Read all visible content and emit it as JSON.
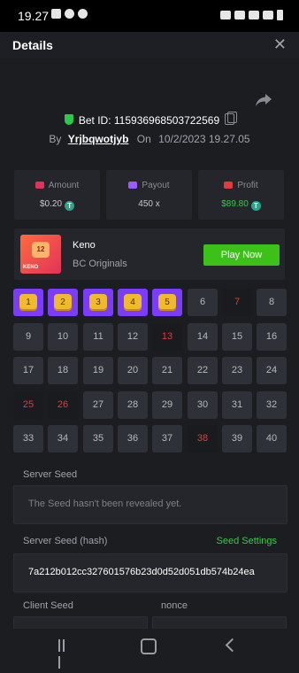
{
  "status": {
    "time": "19.27"
  },
  "header": {
    "title": "Details",
    "close_glyph": "✕"
  },
  "bet": {
    "id_label": "Bet ID:",
    "id_value": "115936968503722569",
    "by_label": "By",
    "user": "Yrjbqwotjyb",
    "on_label": "On",
    "datetime": "10/2/2023 19.27.05"
  },
  "stats": {
    "amount_label": "Amount",
    "amount_value": "$0.20",
    "payout_label": "Payout",
    "payout_value": "450 x",
    "profit_label": "Profit",
    "profit_value": "$89.80"
  },
  "coin_glyph": "T",
  "game": {
    "name": "Keno",
    "provider": "BC Originals",
    "play_label": "Play Now",
    "thumb_ball": "12",
    "thumb_label": "KENO"
  },
  "grid": {
    "cells": [
      {
        "n": "1",
        "state": "hit"
      },
      {
        "n": "2",
        "state": "hit"
      },
      {
        "n": "3",
        "state": "hit"
      },
      {
        "n": "4",
        "state": "hit"
      },
      {
        "n": "5",
        "state": "hit"
      },
      {
        "n": "6",
        "state": "normal"
      },
      {
        "n": "7",
        "state": "pick"
      },
      {
        "n": "8",
        "state": "normal"
      },
      {
        "n": "9",
        "state": "normal"
      },
      {
        "n": "10",
        "state": "normal"
      },
      {
        "n": "11",
        "state": "normal"
      },
      {
        "n": "12",
        "state": "normal"
      },
      {
        "n": "13",
        "state": "pick"
      },
      {
        "n": "14",
        "state": "normal"
      },
      {
        "n": "15",
        "state": "normal"
      },
      {
        "n": "16",
        "state": "normal"
      },
      {
        "n": "17",
        "state": "normal"
      },
      {
        "n": "18",
        "state": "normal"
      },
      {
        "n": "19",
        "state": "normal"
      },
      {
        "n": "20",
        "state": "normal"
      },
      {
        "n": "21",
        "state": "normal"
      },
      {
        "n": "22",
        "state": "normal"
      },
      {
        "n": "23",
        "state": "normal"
      },
      {
        "n": "24",
        "state": "normal"
      },
      {
        "n": "25",
        "state": "pick"
      },
      {
        "n": "26",
        "state": "pick"
      },
      {
        "n": "27",
        "state": "normal"
      },
      {
        "n": "28",
        "state": "normal"
      },
      {
        "n": "29",
        "state": "normal"
      },
      {
        "n": "30",
        "state": "normal"
      },
      {
        "n": "31",
        "state": "normal"
      },
      {
        "n": "32",
        "state": "normal"
      },
      {
        "n": "33",
        "state": "normal"
      },
      {
        "n": "34",
        "state": "normal"
      },
      {
        "n": "35",
        "state": "normal"
      },
      {
        "n": "36",
        "state": "normal"
      },
      {
        "n": "37",
        "state": "normal"
      },
      {
        "n": "38",
        "state": "pick"
      },
      {
        "n": "39",
        "state": "normal"
      },
      {
        "n": "40",
        "state": "normal"
      }
    ]
  },
  "seeds": {
    "server_label": "Server Seed",
    "server_value": "The Seed hasn't been revealed yet.",
    "hash_label": "Server Seed (hash)",
    "settings_label": "Seed Settings",
    "hash_value": "7a212b012cc327601576b23d0d52d051db574b24ea",
    "client_label": "Client Seed",
    "nonce_label": "nonce"
  },
  "colors": {
    "background": "#1b1d21",
    "card": "#24262b",
    "cell": "#2e3138",
    "hit": "#7b3cff",
    "ball": "#f1b92c",
    "miss_number": "#e23b3b",
    "green": "#3bc64a",
    "play_button": "#3bc117"
  }
}
